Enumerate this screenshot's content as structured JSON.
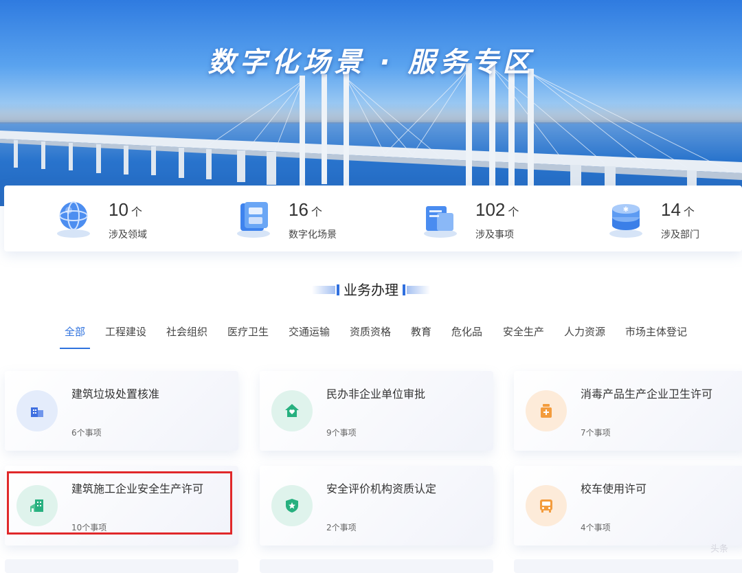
{
  "banner": {
    "title": "数字化场景 · 服务专区"
  },
  "stats": [
    {
      "value": "10",
      "unit": "个",
      "label": "涉及领域",
      "icon": "globe-icon"
    },
    {
      "value": "16",
      "unit": "个",
      "label": "数字化场景",
      "icon": "screen-device-icon"
    },
    {
      "value": "102",
      "unit": "个",
      "label": "涉及事项",
      "icon": "document-stack-icon"
    },
    {
      "value": "14",
      "unit": "个",
      "label": "涉及部门",
      "icon": "server-stack-icon"
    }
  ],
  "section": {
    "title": "业务办理"
  },
  "tabs": [
    {
      "label": "全部",
      "active": true
    },
    {
      "label": "工程建设"
    },
    {
      "label": "社会组织"
    },
    {
      "label": "医疗卫生"
    },
    {
      "label": "交通运输"
    },
    {
      "label": "资质资格"
    },
    {
      "label": "教育"
    },
    {
      "label": "危化品"
    },
    {
      "label": "安全生产"
    },
    {
      "label": "人力资源"
    },
    {
      "label": "市场主体登记"
    }
  ],
  "cards": [
    {
      "title": "建筑垃圾处置核准",
      "count": "6个事项",
      "icon": "building-icon",
      "color": "#3f6fe0"
    },
    {
      "title": "民办非企业单位审批",
      "count": "9个事项",
      "icon": "house-heart-icon",
      "color": "#27b07f"
    },
    {
      "title": "消毒产品生产企业卫生许可",
      "count": "7个事项",
      "icon": "medicine-bottle-icon",
      "color": "#f39c3d"
    },
    {
      "title": "建筑施工企业安全生产许可",
      "count": "10个事项",
      "icon": "office-building-icon",
      "color": "#27b07f"
    },
    {
      "title": "安全评价机构资质认定",
      "count": "2个事项",
      "icon": "shield-star-icon",
      "color": "#27b07f"
    },
    {
      "title": "校车使用许可",
      "count": "4个事项",
      "icon": "bus-icon",
      "color": "#f39c3d"
    }
  ],
  "watermark": "头条"
}
